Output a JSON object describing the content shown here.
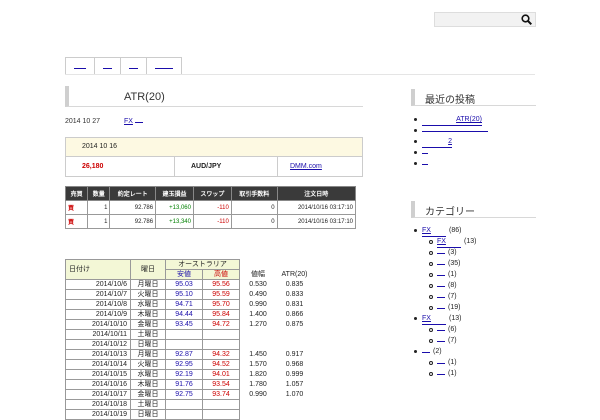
{
  "search": {
    "value": ""
  },
  "nav": {
    "items": [
      "",
      "",
      "",
      ""
    ]
  },
  "post": {
    "title": "ATR(20)",
    "date": "2014 10 27",
    "category": "FX",
    "category2": ""
  },
  "summary": {
    "date": "2014 10 16",
    "amount": "26,180",
    "pair": "AUD/JPY",
    "broker": "DMM.com"
  },
  "trade": {
    "headers": [
      "売買",
      "数量",
      "約定レート",
      "建玉損益",
      "スワップ",
      "取引手数料",
      "注文日時"
    ],
    "rows": [
      [
        "買",
        "1",
        "92.786",
        "+13,060",
        "-110",
        "0",
        "2014/10/16 03:17:10"
      ],
      [
        "買",
        "1",
        "92.786",
        "+13,340",
        "-110",
        "0",
        "2014/10/16 03:17:10"
      ]
    ]
  },
  "atr": {
    "h_date": "日付け",
    "h_day": "曜日",
    "h_country": "オーストラリア",
    "h_low": "安値",
    "h_high": "高値",
    "h_range": "値幅",
    "h_atr": "ATR(20)",
    "rows": [
      [
        "2014/10/6",
        "月曜日",
        "95.03",
        "95.56",
        "0.530",
        "0.835"
      ],
      [
        "2014/10/7",
        "火曜日",
        "95.10",
        "95.59",
        "0.490",
        "0.833"
      ],
      [
        "2014/10/8",
        "水曜日",
        "94.71",
        "95.70",
        "0.990",
        "0.831"
      ],
      [
        "2014/10/9",
        "木曜日",
        "94.44",
        "95.84",
        "1.400",
        "0.866"
      ],
      [
        "2014/10/10",
        "金曜日",
        "93.45",
        "94.72",
        "1.270",
        "0.875"
      ],
      [
        "2014/10/11",
        "土曜日",
        "",
        "",
        "",
        ""
      ],
      [
        "2014/10/12",
        "日曜日",
        "",
        "",
        "",
        ""
      ],
      [
        "2014/10/13",
        "月曜日",
        "92.87",
        "94.32",
        "1.450",
        "0.917"
      ],
      [
        "2014/10/14",
        "火曜日",
        "92.95",
        "94.52",
        "1.570",
        "0.968"
      ],
      [
        "2014/10/15",
        "水曜日",
        "92.19",
        "94.01",
        "1.820",
        "0.999"
      ],
      [
        "2014/10/16",
        "木曜日",
        "91.76",
        "93.54",
        "1.780",
        "1.057"
      ],
      [
        "2014/10/17",
        "金曜日",
        "92.75",
        "93.74",
        "0.990",
        "1.070"
      ],
      [
        "2014/10/18",
        "土曜日",
        "",
        "",
        "",
        ""
      ],
      [
        "2014/10/19",
        "日曜日",
        "",
        "",
        "",
        ""
      ]
    ]
  },
  "sidebar": {
    "recent_title": "最近の投稿",
    "recent": [
      "ATR(20)",
      "",
      "2",
      "",
      ""
    ],
    "cat_title": "カテゴリー",
    "cats": [
      {
        "label": "FX",
        "count": "(86)",
        "sub": false
      },
      {
        "label": "FX",
        "count": "(13)",
        "sub": true
      },
      {
        "label": "",
        "count": "(3)",
        "sub": true
      },
      {
        "label": "",
        "count": "(35)",
        "sub": true
      },
      {
        "label": "",
        "count": "(1)",
        "sub": true
      },
      {
        "label": "",
        "count": "(8)",
        "sub": true
      },
      {
        "label": "",
        "count": "(7)",
        "sub": true
      },
      {
        "label": "",
        "count": "(19)",
        "sub": true
      },
      {
        "label": "FX",
        "count": "(13)",
        "sub": false
      },
      {
        "label": "",
        "count": "(6)",
        "sub": true
      },
      {
        "label": "",
        "count": "(7)",
        "sub": true
      },
      {
        "label": "",
        "count": "(2)",
        "sub": false
      },
      {
        "label": "",
        "count": "(1)",
        "sub": true
      },
      {
        "label": "",
        "count": "(1)",
        "sub": true
      }
    ]
  }
}
